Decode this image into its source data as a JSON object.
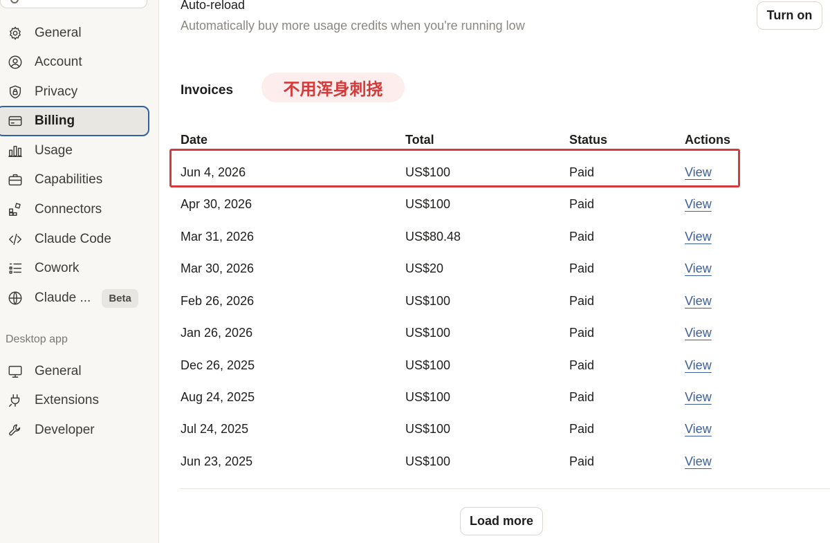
{
  "sidebar": {
    "items": [
      {
        "label": "General",
        "icon": "gear-icon"
      },
      {
        "label": "Account",
        "icon": "user-circle-icon"
      },
      {
        "label": "Privacy",
        "icon": "shield-lock-icon"
      },
      {
        "label": "Billing",
        "icon": "credit-card-icon"
      },
      {
        "label": "Usage",
        "icon": "bar-chart-icon"
      },
      {
        "label": "Capabilities",
        "icon": "briefcase-icon"
      },
      {
        "label": "Connectors",
        "icon": "blocks-icon"
      },
      {
        "label": "Claude Code",
        "icon": "code-icon"
      },
      {
        "label": "Cowork",
        "icon": "checklist-icon"
      },
      {
        "label": "Claude ...",
        "icon": "globe-icon",
        "badge": "Beta"
      }
    ],
    "section_label": "Desktop app",
    "desktop_items": [
      {
        "label": "General",
        "icon": "monitor-icon"
      },
      {
        "label": "Extensions",
        "icon": "plug-icon"
      },
      {
        "label": "Developer",
        "icon": "wrench-icon"
      }
    ]
  },
  "auto_reload": {
    "title": "Auto-reload",
    "description": "Automatically buy more usage credits when you're running low",
    "button": "Turn on"
  },
  "invoices": {
    "title": "Invoices",
    "annotation": "不用浑身刺挠",
    "headers": {
      "date": "Date",
      "total": "Total",
      "status": "Status",
      "actions": "Actions"
    },
    "rows": [
      {
        "date": "Jun 4, 2026",
        "total": "US$100",
        "status": "Paid",
        "action": "View"
      },
      {
        "date": "Apr 30, 2026",
        "total": "US$100",
        "status": "Paid",
        "action": "View"
      },
      {
        "date": "Mar 31, 2026",
        "total": "US$80.48",
        "status": "Paid",
        "action": "View"
      },
      {
        "date": "Mar 30, 2026",
        "total": "US$20",
        "status": "Paid",
        "action": "View"
      },
      {
        "date": "Feb 26, 2026",
        "total": "US$100",
        "status": "Paid",
        "action": "View"
      },
      {
        "date": "Jan 26, 2026",
        "total": "US$100",
        "status": "Paid",
        "action": "View"
      },
      {
        "date": "Dec 26, 2025",
        "total": "US$100",
        "status": "Paid",
        "action": "View"
      },
      {
        "date": "Aug 24, 2025",
        "total": "US$100",
        "status": "Paid",
        "action": "View"
      },
      {
        "date": "Jul 24, 2025",
        "total": "US$100",
        "status": "Paid",
        "action": "View"
      },
      {
        "date": "Jun 23, 2025",
        "total": "US$100",
        "status": "Paid",
        "action": "View"
      }
    ],
    "load_more": "Load more"
  },
  "colors": {
    "link": "#3b5f9a",
    "highlight": "#d63a3a",
    "active_border": "#2f5fa6"
  }
}
